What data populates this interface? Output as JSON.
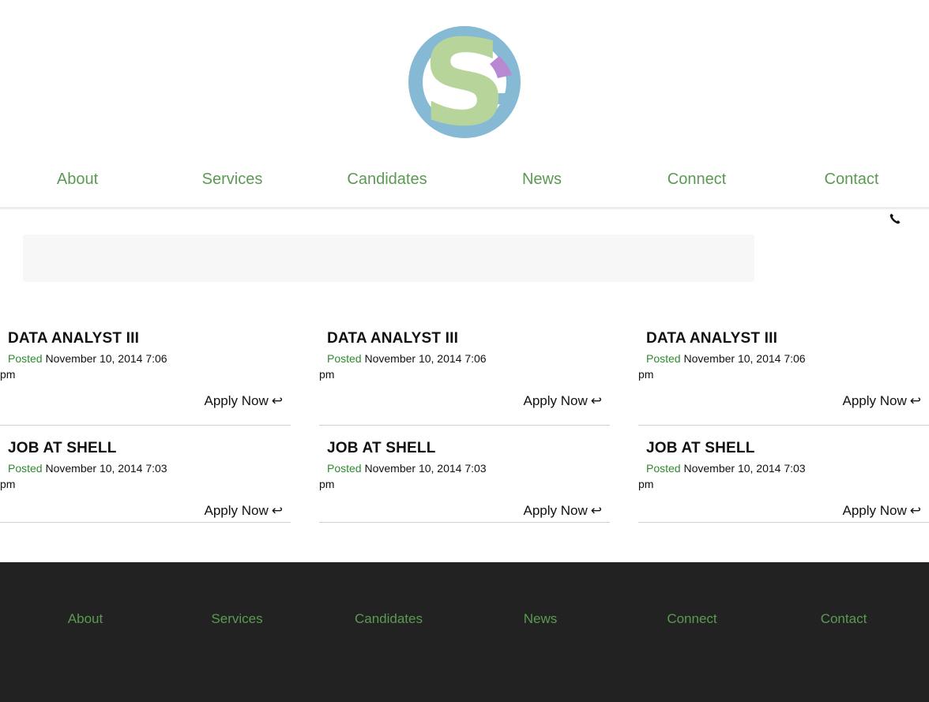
{
  "brand": {
    "logo_icon": "sg-monogram-logo",
    "colors": {
      "green": "#b7d59a",
      "blue": "#86b9d4",
      "purple": "#b988d3"
    }
  },
  "nav": {
    "items": [
      {
        "label": "About"
      },
      {
        "label": "Services"
      },
      {
        "label": "Candidates"
      },
      {
        "label": "News"
      },
      {
        "label": "Connect"
      },
      {
        "label": "Contact"
      }
    ]
  },
  "header": {
    "phone_icon": "phone-icon"
  },
  "search": {
    "placeholder": ""
  },
  "jobs": {
    "rows": [
      [
        {
          "title": "DATA ANALYST III",
          "posted_label": "Posted",
          "posted_date": "November 10, 2014 7:06 pm",
          "apply_label": "Apply Now",
          "apply_icon": "return-arrow-icon"
        },
        {
          "title": "DATA ANALYST III",
          "posted_label": "Posted",
          "posted_date": "November 10, 2014 7:06 pm",
          "apply_label": "Apply Now",
          "apply_icon": "return-arrow-icon"
        },
        {
          "title": "DATA ANALYST III",
          "posted_label": "Posted",
          "posted_date": "November 10, 2014 7:06 pm",
          "apply_label": "Apply Now",
          "apply_icon": "return-arrow-icon"
        }
      ],
      [
        {
          "title": "JOB AT SHELL",
          "posted_label": "Posted",
          "posted_date": "November 10, 2014 7:03 pm",
          "apply_label": "Apply Now",
          "apply_icon": "return-arrow-icon"
        },
        {
          "title": "JOB AT SHELL",
          "posted_label": "Posted",
          "posted_date": "November 10, 2014 7:03 pm",
          "apply_label": "Apply Now",
          "apply_icon": "return-arrow-icon"
        },
        {
          "title": "JOB AT SHELL",
          "posted_label": "Posted",
          "posted_date": "November 10, 2014 7:03 pm",
          "apply_label": "Apply Now",
          "apply_icon": "return-arrow-icon"
        }
      ]
    ]
  },
  "footer": {
    "nav": [
      {
        "label": "About"
      },
      {
        "label": "Services"
      },
      {
        "label": "Candidates"
      },
      {
        "label": "News"
      },
      {
        "label": "Connect"
      },
      {
        "label": "Contact"
      }
    ]
  }
}
